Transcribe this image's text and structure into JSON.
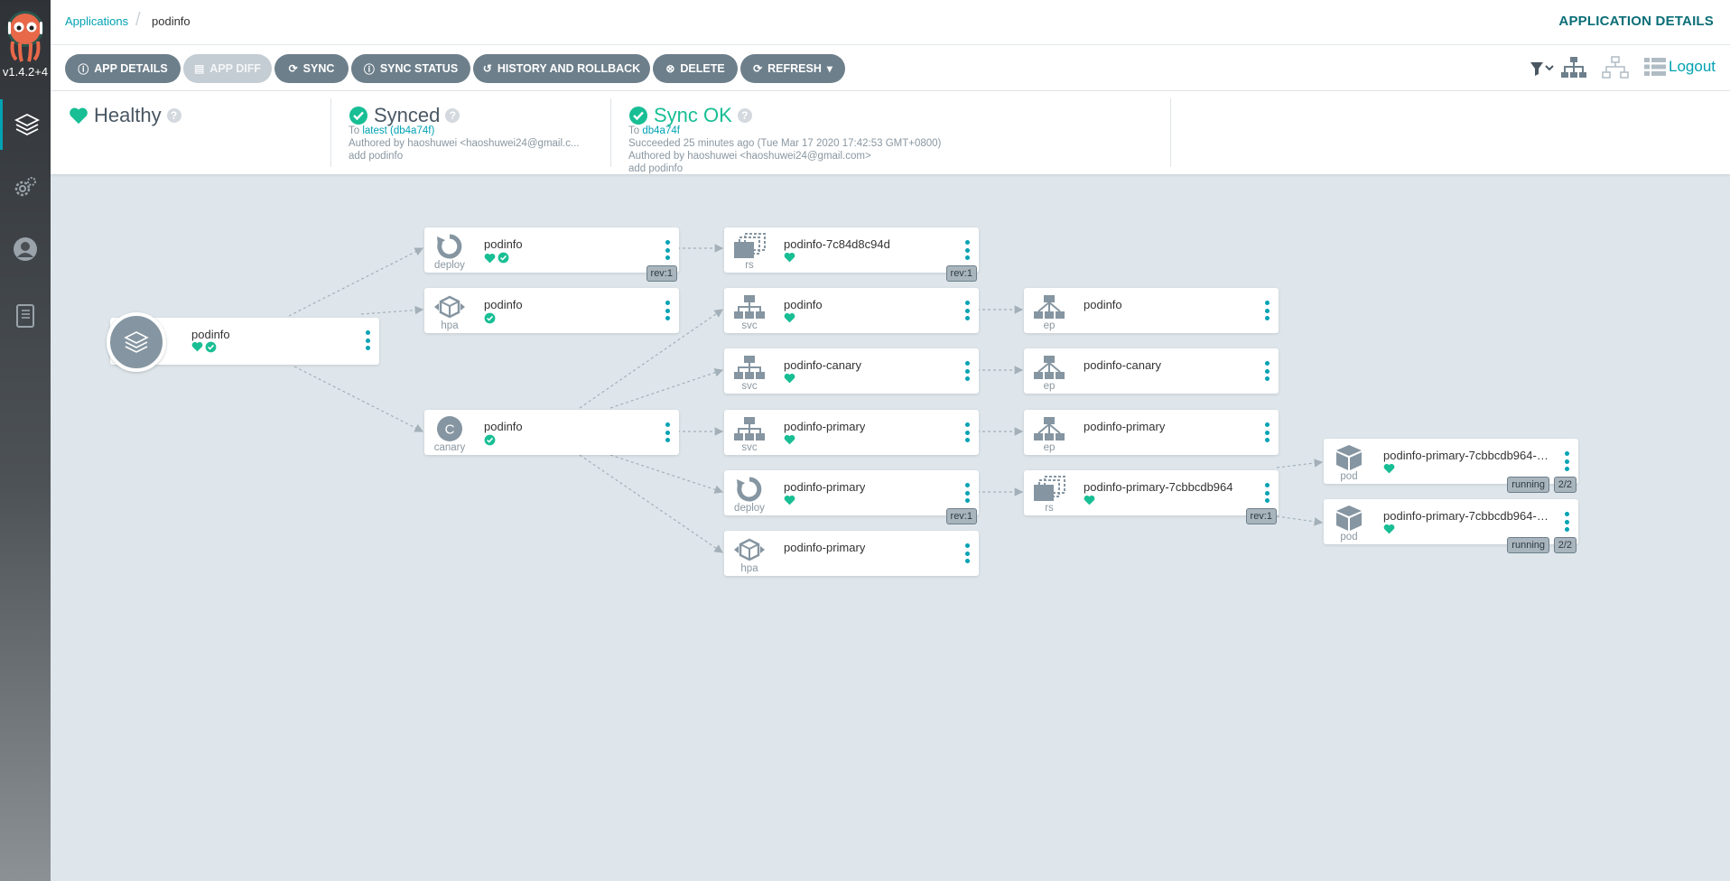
{
  "sidebar": {
    "version": "v1.4.2+4",
    "items": [
      "applications",
      "settings",
      "user",
      "docs"
    ]
  },
  "breadcrumb": {
    "root": "Applications",
    "current": "podinfo"
  },
  "page_title": "APPLICATION DETAILS",
  "toolbar": {
    "app_details": "APP DETAILS",
    "app_diff": "APP DIFF",
    "sync": "SYNC",
    "sync_status": "SYNC STATUS",
    "history": "HISTORY AND ROLLBACK",
    "delete": "DELETE",
    "refresh": "REFRESH",
    "logout": "Logout"
  },
  "status": {
    "health": {
      "label": "Healthy"
    },
    "sync": {
      "label": "Synced",
      "to_prefix": "To",
      "to_value": "latest (db4a74f)",
      "author": "Authored by haoshuwei <haoshuwei24@gmail.c...",
      "message": "add podinfo"
    },
    "operation": {
      "label": "Sync OK",
      "to_prefix": "To",
      "to_value": "db4a74f",
      "time": "Succeeded 25 minutes ago (Tue Mar 17 2020 17:42:53 GMT+0800)",
      "author": "Authored by haoshuwei <haoshuwei24@gmail.com>",
      "message": "add podinfo"
    }
  },
  "colors": {
    "accent": "#00a2b3",
    "healthy": "#18be94",
    "button": "#6d7f8b",
    "icon": "#8595a1"
  },
  "graph": {
    "app": {
      "name": "podinfo"
    },
    "nodes": [
      {
        "kind": "deploy",
        "name": "podinfo",
        "rev": "rev:1"
      },
      {
        "kind": "hpa",
        "name": "podinfo"
      },
      {
        "kind": "canary",
        "name": "podinfo"
      },
      {
        "kind": "rs",
        "name": "podinfo-7c84d8c94d",
        "rev": "rev:1"
      },
      {
        "kind": "svc",
        "name": "podinfo"
      },
      {
        "kind": "svc",
        "name": "podinfo-canary"
      },
      {
        "kind": "svc",
        "name": "podinfo-primary"
      },
      {
        "kind": "deploy",
        "name": "podinfo-primary",
        "rev": "rev:1"
      },
      {
        "kind": "hpa",
        "name": "podinfo-primary"
      },
      {
        "kind": "ep",
        "name": "podinfo"
      },
      {
        "kind": "ep",
        "name": "podinfo-canary"
      },
      {
        "kind": "ep",
        "name": "podinfo-primary"
      },
      {
        "kind": "rs",
        "name": "podinfo-primary-7cbbcdb964",
        "rev": "rev:1"
      },
      {
        "kind": "pod",
        "name": "podinfo-primary-7cbbcdb964-9...",
        "status": "running",
        "ready": "2/2"
      },
      {
        "kind": "pod",
        "name": "podinfo-primary-7cbbcdb964-h...",
        "status": "running",
        "ready": "2/2"
      }
    ]
  }
}
